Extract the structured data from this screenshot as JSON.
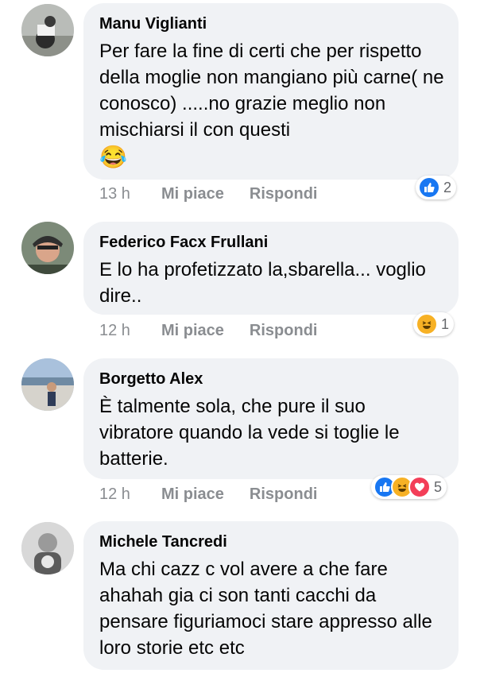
{
  "comments": [
    {
      "author": "Manu Viglianti",
      "text": "Per fare la fine di certi che per rispetto della moglie non mangiano più carne( ne conosco) .....no grazie meglio non mischiarsi il con questi",
      "emoji": "😂",
      "time": "13 h",
      "like_label": "Mi piace",
      "reply_label": "Rispondi",
      "reactions": [
        "like-icon"
      ],
      "reaction_count": "2"
    },
    {
      "author": "Federico Facx Frullani",
      "text": "E lo ha profetizzato la,sbarella... voglio dire..",
      "time": "12 h",
      "like_label": "Mi piace",
      "reply_label": "Rispondi",
      "reactions": [
        "haha-icon"
      ],
      "reaction_count": "1"
    },
    {
      "author": "Borgetto Alex",
      "text": "È talmente sola, che pure il suo vibratore quando la vede si toglie le batterie.",
      "time": "12 h",
      "like_label": "Mi piace",
      "reply_label": "Rispondi",
      "reactions": [
        "like-icon",
        "haha-icon",
        "love-icon"
      ],
      "reaction_count": "5"
    },
    {
      "author": "Michele Tancredi",
      "text": "Ma chi cazz c vol avere a che fare ahahah gia ci son tanti cacchi da pensare figuriamoci stare appresso alle loro storie etc etc"
    }
  ],
  "colors": {
    "bubble": "#f0f2f5",
    "meta": "#8a8d91",
    "like": "#1877f2",
    "haha": "#f7b125",
    "love": "#f33e58"
  }
}
